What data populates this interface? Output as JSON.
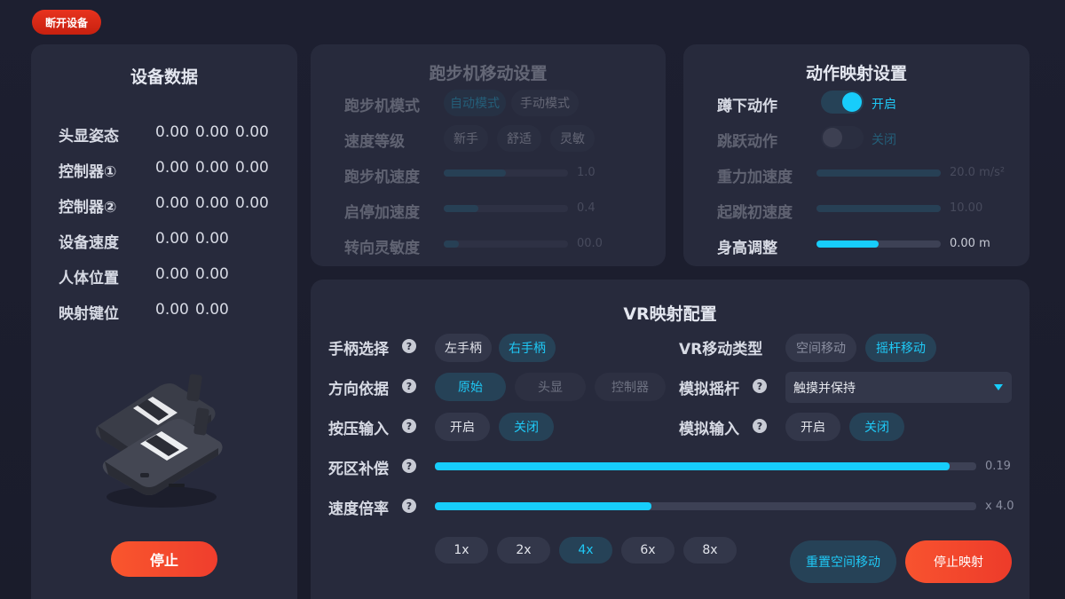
{
  "header": {
    "disconnect_label": "断开设备"
  },
  "device_data": {
    "title": "设备数据",
    "rows": [
      {
        "label": "头显姿态",
        "values": [
          "0.00",
          "0.00",
          "0.00"
        ]
      },
      {
        "label": "控制器①",
        "values": [
          "0.00",
          "0.00",
          "0.00"
        ]
      },
      {
        "label": "控制器②",
        "values": [
          "0.00",
          "0.00",
          "0.00"
        ]
      },
      {
        "label": "设备速度",
        "values": [
          "0.00",
          "0.00"
        ]
      },
      {
        "label": "人体位置",
        "values": [
          "0.00",
          "0.00"
        ]
      },
      {
        "label": "映射键位",
        "values": [
          "0.00",
          "0.00"
        ]
      }
    ],
    "stop_label": "停止"
  },
  "treadmill": {
    "title": "跑步机移动设置",
    "mode_label": "跑步机模式",
    "modes": [
      "自动模式",
      "手动模式"
    ],
    "mode_selected": "自动模式",
    "level_label": "速度等级",
    "levels": [
      "新手",
      "舒适",
      "灵敏"
    ],
    "speed_label": "跑步机速度",
    "speed_value": "1.0",
    "speed_fraction": 0.5,
    "accel_label": "启停加速度",
    "accel_value": "0.4",
    "accel_fraction": 0.28,
    "turn_label": "转向灵敏度",
    "turn_value": "00.0",
    "turn_fraction": 0.12
  },
  "action_mapping": {
    "title": "动作映射设置",
    "squat_label": "蹲下动作",
    "squat_state": "开启",
    "jump_label": "跳跃动作",
    "jump_state": "关闭",
    "gravity_label": "重力加速度",
    "gravity_value": "20.0 m/s²",
    "gravity_fraction": 1.0,
    "jump_speed_label": "起跳初速度",
    "jump_speed_value": "10.00",
    "jump_speed_fraction": 1.0,
    "height_label": "身高调整",
    "height_value": "0.00 m",
    "height_fraction": 0.5
  },
  "vr_config": {
    "title": "VR映射配置",
    "controller_label": "手柄选择",
    "controller_options": [
      "左手柄",
      "右手柄"
    ],
    "controller_selected": "右手柄",
    "direction_label": "方向依据",
    "direction_options": [
      "原始",
      "头显",
      "控制器"
    ],
    "direction_selected": "原始",
    "press_label": "按压输入",
    "press_options": [
      "开启",
      "关闭"
    ],
    "press_selected": "关闭",
    "deadzone_label": "死区补偿",
    "deadzone_value": "0.19",
    "deadzone_fraction": 0.95,
    "speed_mult_label": "速度倍率",
    "speed_mult_value": "x 4.0",
    "speed_mult_fraction": 0.4,
    "multipliers": [
      "1x",
      "2x",
      "4x",
      "6x",
      "8x"
    ],
    "multiplier_selected": "4x",
    "move_type_label": "VR移动类型",
    "move_type_options": [
      "空间移动",
      "摇杆移动"
    ],
    "move_type_selected": "摇杆移动",
    "stick_label": "模拟摇杆",
    "stick_value": "触摸并保持",
    "analog_label": "模拟输入",
    "analog_options": [
      "开启",
      "关闭"
    ],
    "analog_selected": "关闭",
    "reset_label": "重置空间移动",
    "stop_map_label": "停止映射"
  },
  "colors": {
    "accent": "#17cdfb",
    "danger": "#ef3e2d",
    "panel": "#272a3c"
  }
}
